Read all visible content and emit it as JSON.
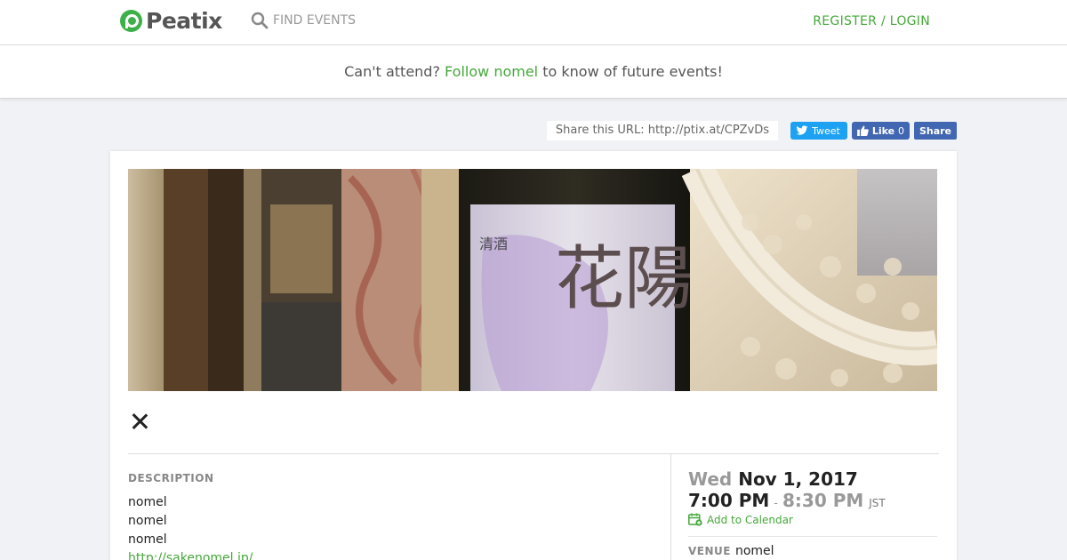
{
  "header": {
    "logo_text": "Peatix",
    "find_events": "FIND EVENTS",
    "register_login": "REGISTER / LOGIN"
  },
  "follow_bar": {
    "prefix": "Can't attend?",
    "link": "Follow nomel",
    "suffix": "to know of future events!"
  },
  "share": {
    "url_text": "Share this URL: http://ptix.at/CPZvDs",
    "tweet": "Tweet",
    "like": "Like",
    "like_count": "0",
    "share": "Share"
  },
  "hero": {
    "label_chars": "花陽",
    "label_small": "清酒"
  },
  "description": {
    "label": "DESCRIPTION",
    "lines": [
      "nomel",
      "nomel",
      "nomel"
    ],
    "link": "http://sakenomel.jp/"
  },
  "event": {
    "day_of_week": "Wed",
    "date": "Nov 1, 2017",
    "start_time": "7:00 PM",
    "separator": "-",
    "end_time": "8:30 PM",
    "timezone": "JST",
    "add_to_calendar": "Add to Calendar",
    "venue_label": "VENUE",
    "venue": "nomel"
  },
  "colors": {
    "brand_green": "#45a83a",
    "twitter_blue": "#1da1f2",
    "facebook_blue": "#4267b2",
    "page_bg": "#f1f2f5"
  }
}
